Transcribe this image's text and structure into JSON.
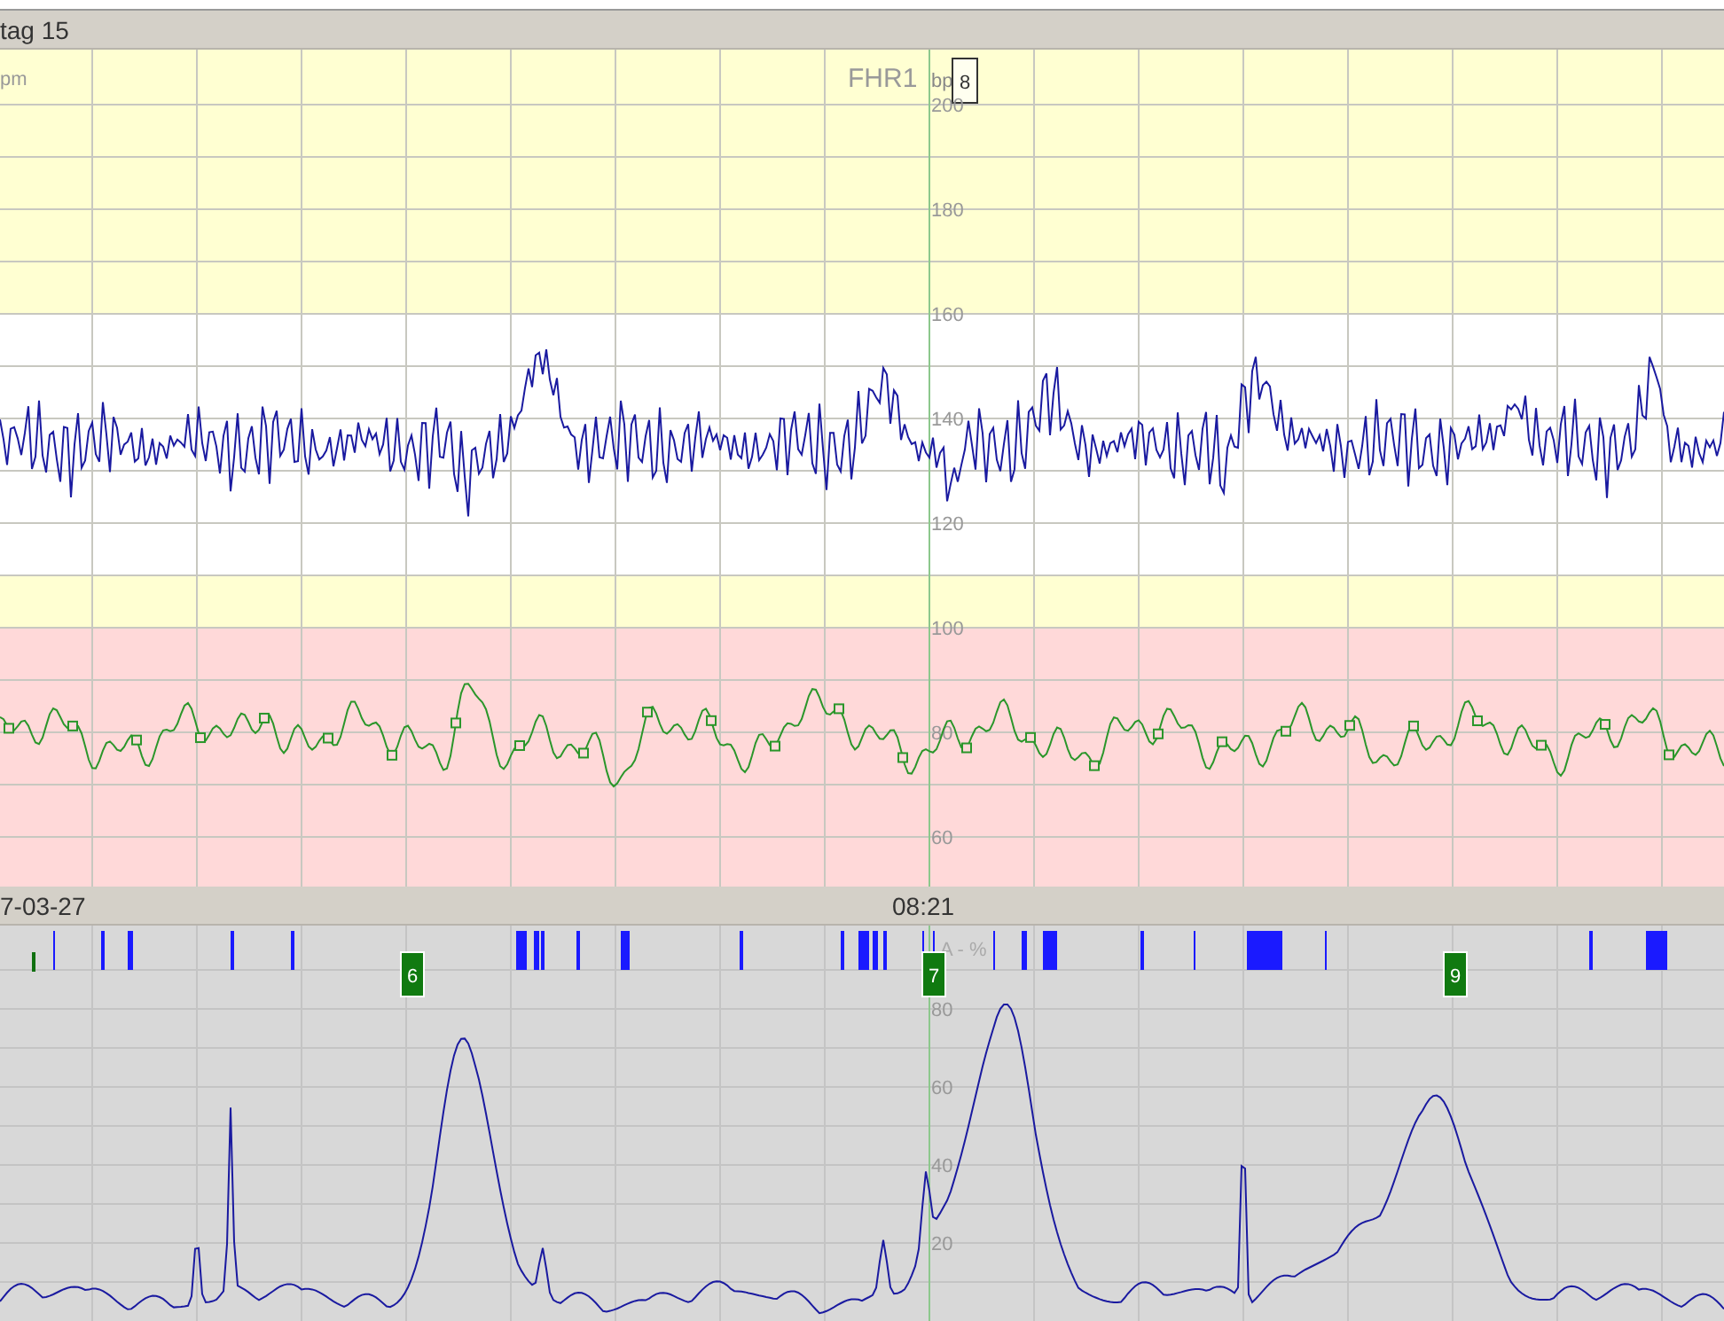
{
  "header": {
    "title": "tag 15"
  },
  "fhr_panel": {
    "unit_label": "pm",
    "title": "FHR1",
    "scale_unit": "bp",
    "marker": "8",
    "y_labels": [
      "200",
      "180",
      "160",
      "140",
      "120",
      "100",
      "80",
      "60"
    ]
  },
  "time_bar": {
    "date": "7-03-27",
    "time": "08:21"
  },
  "toco_panel": {
    "scale_unit": "A - %",
    "y_labels": [
      "80",
      "60",
      "40",
      "20"
    ],
    "event_markers": [
      {
        "label": "6"
      },
      {
        "label": "7"
      },
      {
        "label": "9"
      }
    ]
  }
}
